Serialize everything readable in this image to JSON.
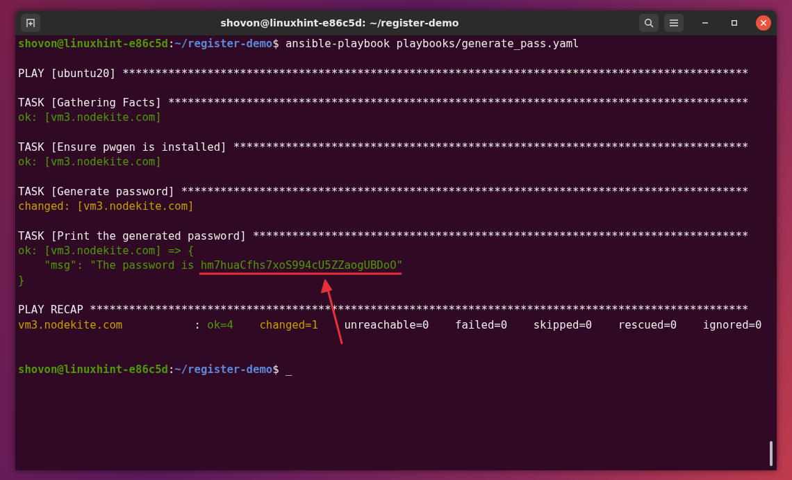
{
  "window": {
    "title": "shovon@linuxhint-e86c5d: ~/register-demo"
  },
  "terminal": {
    "lines": [
      {
        "kind": "text",
        "segments": [
          {
            "kind": "user",
            "text": "shovon@linuxhint-e86c5d"
          },
          {
            "kind": "plain",
            "text": ":"
          },
          {
            "kind": "path",
            "text": "~/register-demo"
          },
          {
            "kind": "plain",
            "text": "$ ansible-playbook playbooks/generate_pass.yaml"
          }
        ]
      },
      {
        "kind": "blank"
      },
      {
        "kind": "text",
        "segments": [
          {
            "kind": "plain",
            "text": "PLAY [ubuntu20] ************************************************************************************************"
          }
        ]
      },
      {
        "kind": "blank"
      },
      {
        "kind": "text",
        "segments": [
          {
            "kind": "plain",
            "text": "TASK [Gathering Facts] *****************************************************************************************"
          }
        ]
      },
      {
        "kind": "text",
        "segments": [
          {
            "kind": "ok",
            "text": "ok: [vm3.nodekite.com]"
          }
        ]
      },
      {
        "kind": "blank"
      },
      {
        "kind": "text",
        "segments": [
          {
            "kind": "plain",
            "text": "TASK [Ensure pwgen is installed] *******************************************************************************"
          }
        ]
      },
      {
        "kind": "text",
        "segments": [
          {
            "kind": "ok",
            "text": "ok: [vm3.nodekite.com]"
          }
        ]
      },
      {
        "kind": "blank"
      },
      {
        "kind": "text",
        "segments": [
          {
            "kind": "plain",
            "text": "TASK [Generate password] ***************************************************************************************"
          }
        ]
      },
      {
        "kind": "text",
        "segments": [
          {
            "kind": "changed",
            "text": "changed: [vm3.nodekite.com]"
          }
        ]
      },
      {
        "kind": "blank"
      },
      {
        "kind": "text",
        "segments": [
          {
            "kind": "plain",
            "text": "TASK [Print the generated password] ****************************************************************************"
          }
        ]
      },
      {
        "kind": "text",
        "segments": [
          {
            "kind": "ok",
            "text": "ok: [vm3.nodekite.com] => {"
          }
        ]
      },
      {
        "kind": "text",
        "segments": [
          {
            "kind": "ok",
            "text": "    \"msg\": \"The password is hm7huaCfhs7xoS994cU5ZZaogUBDoO\""
          }
        ]
      },
      {
        "kind": "text",
        "segments": [
          {
            "kind": "ok",
            "text": "}"
          }
        ]
      },
      {
        "kind": "blank"
      },
      {
        "kind": "text",
        "segments": [
          {
            "kind": "plain",
            "text": "PLAY RECAP *****************************************************************************************************"
          }
        ]
      },
      {
        "kind": "text",
        "segments": [
          {
            "kind": "changed",
            "text": "vm3.nodekite.com"
          },
          {
            "kind": "plain",
            "text": "           : "
          },
          {
            "kind": "ok",
            "text": "ok=4    "
          },
          {
            "kind": "changed",
            "text": "changed=1"
          },
          {
            "kind": "plain",
            "text": "    unreachable=0    failed=0    skipped=0    rescued=0    ignored=0"
          }
        ]
      },
      {
        "kind": "blank"
      },
      {
        "kind": "blank"
      },
      {
        "kind": "text",
        "segments": [
          {
            "kind": "user",
            "text": "shovon@linuxhint-e86c5d"
          },
          {
            "kind": "plain",
            "text": ":"
          },
          {
            "kind": "path",
            "text": "~/register-demo"
          },
          {
            "kind": "plain",
            "text": "$ _"
          }
        ]
      }
    ]
  }
}
